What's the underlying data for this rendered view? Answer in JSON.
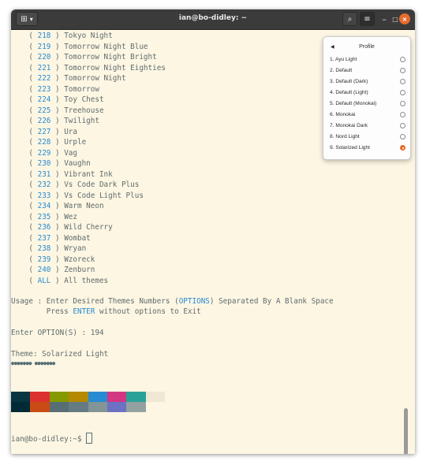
{
  "titlebar": {
    "title": "ian@bo-didley: ~",
    "new_tab_glyph": "⊞",
    "dropdown_glyph": "▾",
    "search_glyph": "⌕",
    "menu_glyph": "≡",
    "minimize_glyph": "–",
    "maximize_glyph": "□",
    "close_glyph": "×"
  },
  "terminal": {
    "theme_list": [
      {
        "num": "218",
        "name": "Tokyo Night"
      },
      {
        "num": "219",
        "name": "Tomorrow Night Blue"
      },
      {
        "num": "220",
        "name": "Tomorrow Night Bright"
      },
      {
        "num": "221",
        "name": "Tomorrow Night Eighties"
      },
      {
        "num": "222",
        "name": "Tomorrow Night"
      },
      {
        "num": "223",
        "name": "Tomorrow"
      },
      {
        "num": "224",
        "name": "Toy Chest"
      },
      {
        "num": "225",
        "name": "Treehouse"
      },
      {
        "num": "226",
        "name": "Twilight"
      },
      {
        "num": "227",
        "name": "Ura"
      },
      {
        "num": "228",
        "name": "Urple"
      },
      {
        "num": "229",
        "name": "Vag"
      },
      {
        "num": "230",
        "name": "Vaughn"
      },
      {
        "num": "231",
        "name": "Vibrant Ink"
      },
      {
        "num": "232",
        "name": "Vs Code Dark Plus"
      },
      {
        "num": "233",
        "name": "Vs Code Light Plus"
      },
      {
        "num": "234",
        "name": "Warm Neon"
      },
      {
        "num": "235",
        "name": "Wez"
      },
      {
        "num": "236",
        "name": "Wild Cherry"
      },
      {
        "num": "237",
        "name": "Wombat"
      },
      {
        "num": "238",
        "name": "Wryan"
      },
      {
        "num": "239",
        "name": "Wzoreck"
      },
      {
        "num": "240",
        "name": "Zenburn"
      },
      {
        "num": "ALL",
        "name": "All themes"
      }
    ],
    "usage_prefix": "Usage : Enter Desired Themes Numbers (",
    "usage_options": "OPTIONS",
    "usage_suffix": ") Separated By A Blank Space",
    "press_prefix": "        Press ",
    "press_enter": "ENTER",
    "press_suffix": " without options to Exit",
    "enter_option": "Enter OPTION(S) : 194",
    "theme_line": "Theme: Solarized Light",
    "dots_line": "●●●●●●● ●●●●●●●",
    "palette_top": [
      "#073642",
      "#dc322f",
      "#859900",
      "#b58900",
      "#268bd2",
      "#d33682",
      "#2aa198",
      "#eee8d5"
    ],
    "palette_bottom": [
      "#002b36",
      "#cb4b16",
      "#586e75",
      "#657b83",
      "#839496",
      "#6c71c4",
      "#93a1a1",
      "#fdf6e3"
    ],
    "prompt": "ian@bo-didley:~$ "
  },
  "profile_menu": {
    "title": "Profile",
    "back_glyph": "◀",
    "items": [
      {
        "label": "1. Ayu Light",
        "selected": false
      },
      {
        "label": "2. Default",
        "selected": false
      },
      {
        "label": "3. Default (Dark)",
        "selected": false
      },
      {
        "label": "4. Default (Light)",
        "selected": false
      },
      {
        "label": "5. Default (Monokai)",
        "selected": false
      },
      {
        "label": "6. Monokai",
        "selected": false
      },
      {
        "label": "7. Monokai Dark",
        "selected": false
      },
      {
        "label": "8. Nord Light",
        "selected": false
      },
      {
        "label": "9. Solarized Light",
        "selected": true
      }
    ]
  },
  "colors": {
    "terminal_bg": "#fdf6e3",
    "terminal_fg": "#5f6c6d",
    "number_blue": "#268bd2",
    "titlebar_bg": "#3b3b3b",
    "accent_orange": "#e66b2e"
  }
}
